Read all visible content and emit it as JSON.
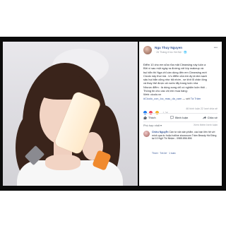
{
  "post": {
    "author": "Nga Thuy Nguyen",
    "meta": "· 26 Tháng 6 lúc Hà Nội · 🌐",
    "body": [
      "Điểm 10 cho em sữa rửa mặt Cleansing này luôn a",
      "Bởi vì sau một ngày ra đường với lớp makeup và",
      "bụi bẩn thì Nga chỉ cần dùng đến em Cleansing mới",
      "Cicolo này thui mà . Ưu điểm của em ấy là làm sạch",
      "sâu bụi bẩn cũng như bã nhờn , se khít lỗ chân lông",
      "và thay thế được cả nước tẩy trang luôn nha",
      "Nhược điểm : là dùng song chỉ có nghiện luôn thôi ..",
      "Thông tin cho các chị em mua hàng:",
      "Web: cicolo.vn"
    ],
    "hashtag": "#Cicolo_con_loc_mau_da_cam",
    "with_label": "— với",
    "with_name": "Tà Trâm",
    "reaction_count": "1,2K",
    "reactions_right": "46 bình luận  22 lượt chia sẻ",
    "actions": {
      "like": "Thích",
      "comment": "Bình luận",
      "share": "Chia sẻ"
    },
    "sort_label": "Phù hợp nhất ▾",
    "view_comments": "Xem thêm bình luận"
  },
  "comment": {
    "name": "Chiều Nguyễn",
    "text": " Cần tư vấn sản phẩm, các bạn liên hệ với mình qua tư hoặc hotline showroom Trâm Beauty Hà Đông tại 10 Ngõ Thi Nhậm - 0985.856.896",
    "actions": "Thích · Trả lời · 1 tuần"
  },
  "colors": {
    "link": "#385898",
    "orange_cap": "#f08a2e",
    "frame": "#0b0b0b"
  }
}
